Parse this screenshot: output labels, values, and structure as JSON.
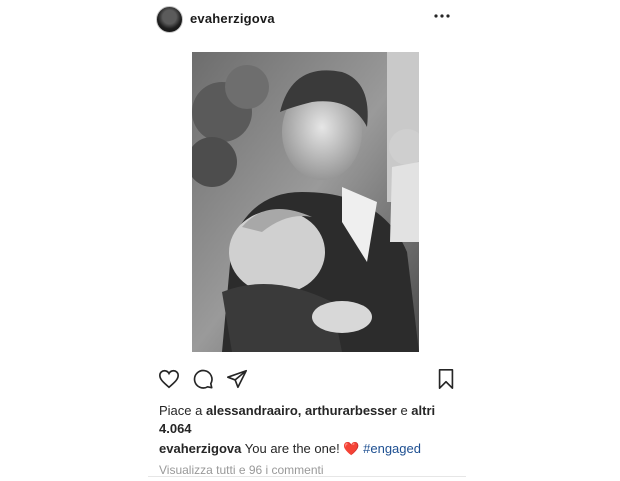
{
  "post": {
    "username": "evaherzigova",
    "likes": {
      "prefix": "Piace a",
      "user1": "alessandraairo",
      "separator": ",",
      "user2": "arthurarbesser",
      "conjunction": "e",
      "others_label": "altri",
      "others_count": "4.064"
    },
    "caption": {
      "username": "evaherzigova",
      "text": "You are the one!",
      "emoji": "❤️",
      "hashtag": "#engaged"
    },
    "view_comments": "Visualizza tutti e 96 i commenti"
  },
  "icons": {
    "more": "more-horizontal-icon",
    "like": "heart-outline-icon",
    "comment": "comment-bubble-icon",
    "share": "paper-plane-icon",
    "save": "bookmark-icon"
  },
  "colors": {
    "text": "#262626",
    "muted": "#999999",
    "hashtag": "#1d4f91",
    "heart": "#e0163c"
  }
}
